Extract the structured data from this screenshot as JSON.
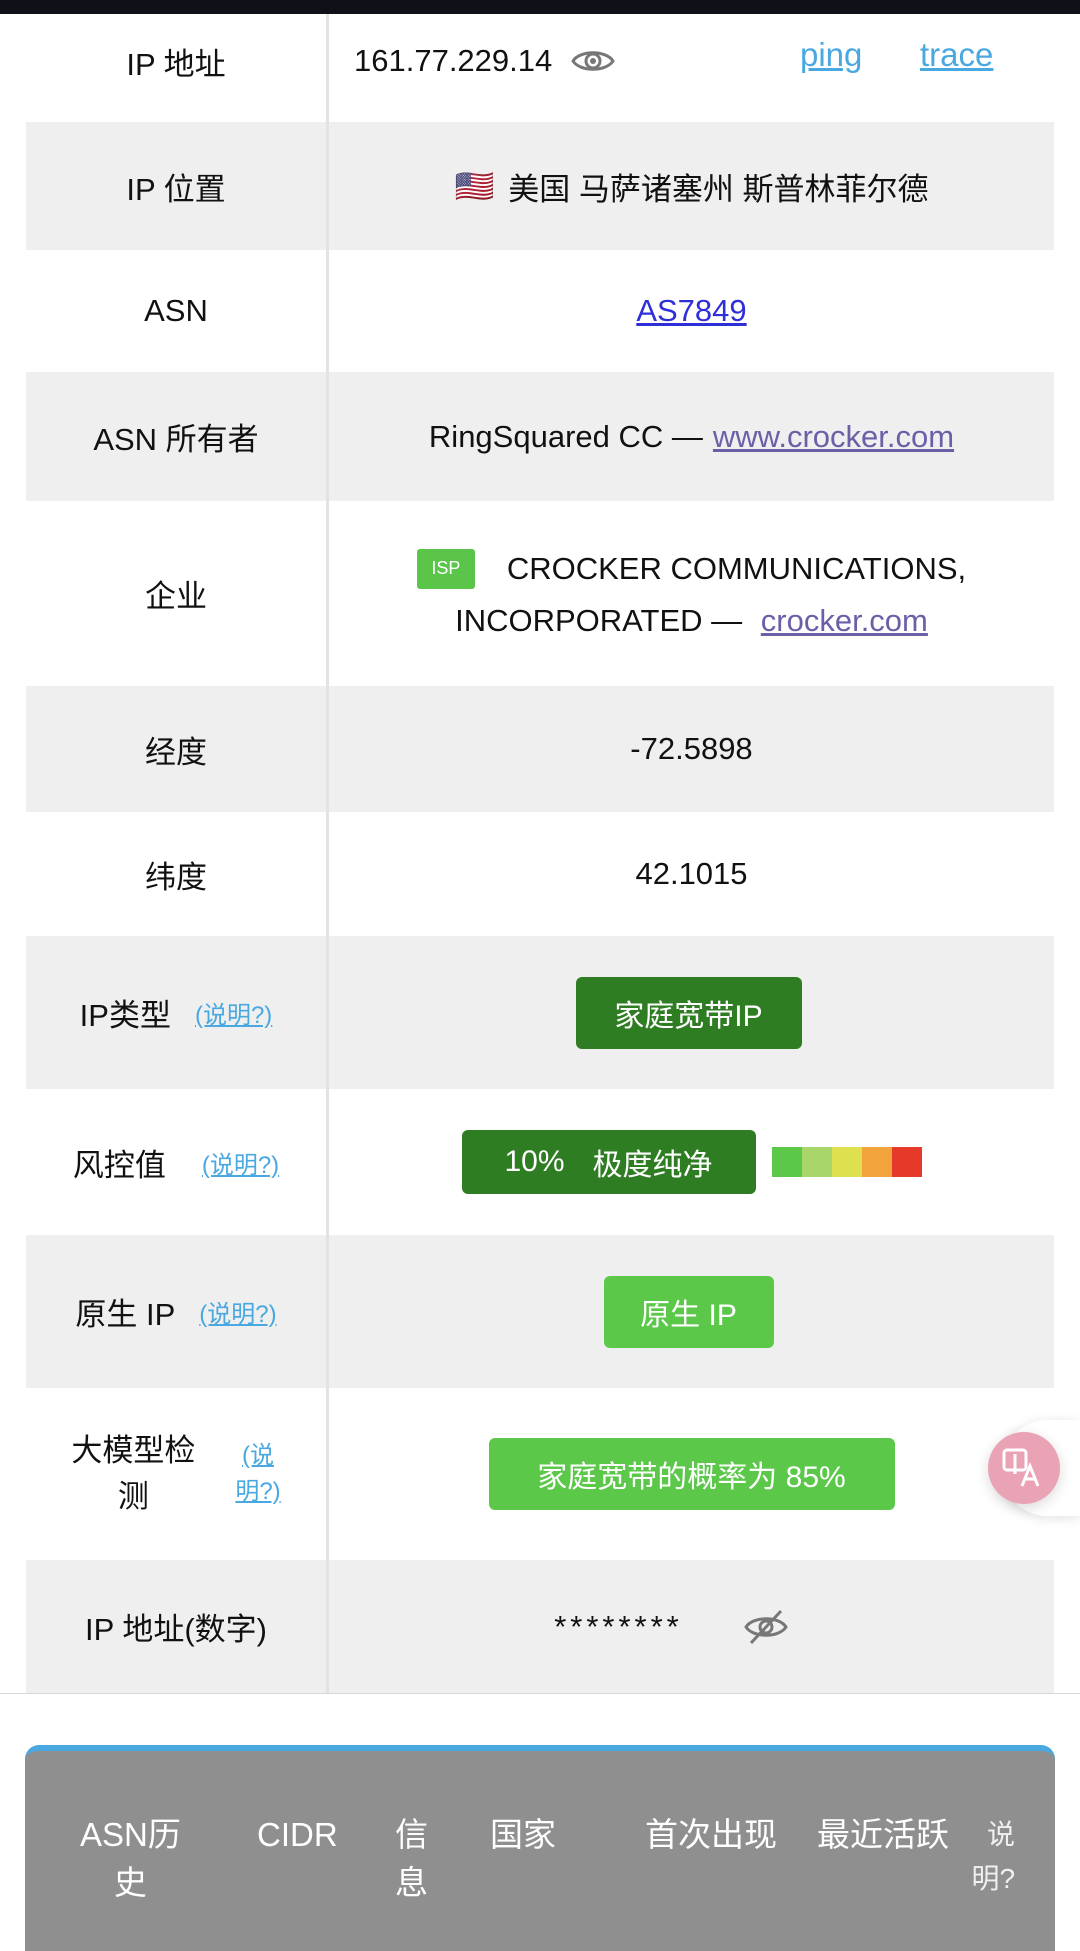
{
  "rows": [
    {
      "label": "IP 地址",
      "value": "161.77.229.14",
      "ping": "ping",
      "trace": "trace"
    },
    {
      "label": "IP 位置",
      "flag": "🇺🇸",
      "value": "美国 马萨诸塞州 斯普林菲尔德"
    },
    {
      "label": "ASN",
      "value": "AS7849"
    },
    {
      "label": "ASN 所有者",
      "owner": "RingSquared CC —",
      "link": "www.crocker.com"
    },
    {
      "label": "企业",
      "badge": "ISP",
      "line1": "CROCKER COMMUNICATIONS,",
      "line2": "INCORPORATED —",
      "link": "crocker.com"
    },
    {
      "label": "经度",
      "value": "-72.5898"
    },
    {
      "label": "纬度",
      "value": "42.1015"
    },
    {
      "label": "IP类型",
      "help": "(说明?)",
      "value": "家庭宽带IP"
    },
    {
      "label": "风控值",
      "help": "(说明?)",
      "percent": "10%",
      "level": "极度纯净"
    },
    {
      "label": "原生 IP",
      "help": "(说明?)",
      "value": "原生 IP"
    },
    {
      "label_line1": "大模型检",
      "label_line2": "测",
      "help_line1": "(说",
      "help_line2": "明?)",
      "value": "家庭宽带的概率为 85%"
    },
    {
      "label": "IP 地址(数字)",
      "value": "********"
    }
  ],
  "colors": {
    "dark_green": "#2f7d22",
    "light_green": "#5cc84a",
    "risk_scale": [
      "#5cc84a",
      "#a9d66b",
      "#dfe050",
      "#f0a43b",
      "#e53a2a"
    ]
  },
  "bottom_headers": {
    "asn_history_1": "ASN历",
    "asn_history_2": "史",
    "cidr": "CIDR",
    "info_1": "信",
    "info_2": "息",
    "country": "国家",
    "first_seen": "首次出现",
    "last_active": "最近活跃",
    "note_1": "说",
    "note_2": "明?"
  },
  "icons": {
    "eye": "eye-icon",
    "eye_off": "eye-off-icon",
    "translate": "translate-icon"
  }
}
